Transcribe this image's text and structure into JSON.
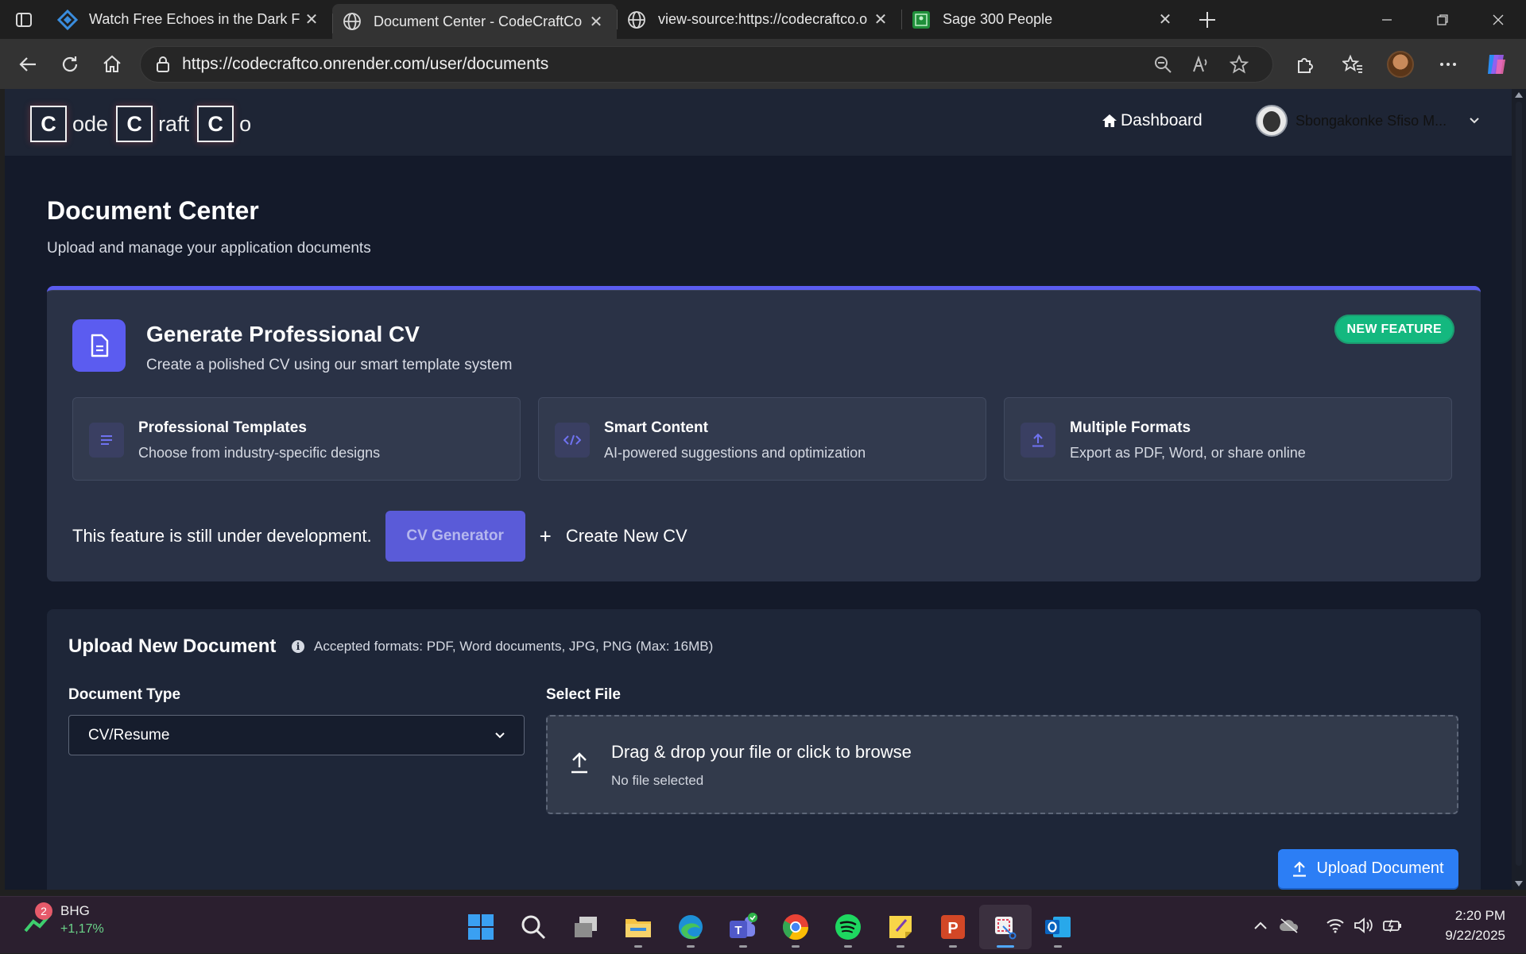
{
  "browser": {
    "tabs": [
      {
        "title": "Watch Free Echoes in the Dark Fu",
        "icon": "app-icon",
        "active": false
      },
      {
        "title": "Document Center - CodeCraftCo",
        "icon": "globe-icon",
        "active": true
      },
      {
        "title": "view-source:https://codecraftco.o",
        "icon": "globe-icon",
        "active": false
      },
      {
        "title": "Sage 300 People",
        "icon": "sage-icon",
        "active": false
      }
    ],
    "url": "https://codecraftco.onrender.com/user/documents"
  },
  "site": {
    "logo": {
      "letters": [
        "C",
        "C",
        "C"
      ],
      "rests": [
        "ode",
        "raft",
        "o"
      ]
    },
    "nav": {
      "dashboard_label": "Dashboard"
    },
    "user": {
      "name": "Sbongakonke Sfiso M..."
    }
  },
  "page": {
    "title": "Document Center",
    "subtitle": "Upload and manage your application documents"
  },
  "cv_card": {
    "title": "Generate Professional CV",
    "description": "Create a polished CV using our smart template system",
    "badge": "NEW FEATURE",
    "features": [
      {
        "title": "Professional Templates",
        "description": "Choose from industry-specific designs",
        "icon": "list-icon"
      },
      {
        "title": "Smart Content",
        "description": "AI-powered suggestions and optimization",
        "icon": "code-icon"
      },
      {
        "title": "Multiple Formats",
        "description": "Export as PDF, Word, or share online",
        "icon": "upload-icon"
      }
    ],
    "dev_note": "This feature is still under development.",
    "cv_generator_label": "CV Generator",
    "create_label": "Create New CV"
  },
  "upload": {
    "title": "Upload New Document",
    "info": "Accepted formats: PDF, Word documents, JPG, PNG (Max: 16MB)",
    "doc_type_label": "Document Type",
    "doc_type_value": "CV/Resume",
    "file_label": "Select File",
    "dropzone_title": "Drag & drop your file or click to browse",
    "file_status": "No file selected",
    "upload_button": "Upload Document"
  },
  "taskbar": {
    "widget": {
      "badge": "2",
      "name": "BHG",
      "change": "+1,17%"
    },
    "time": "2:20 PM",
    "date": "9/22/2025"
  },
  "colors": {
    "accent": "#5b5cf0",
    "badge": "#14b87f",
    "primary_button": "#2c7ef5",
    "page_background": "#141a2a",
    "card_background": "#2a3246"
  }
}
